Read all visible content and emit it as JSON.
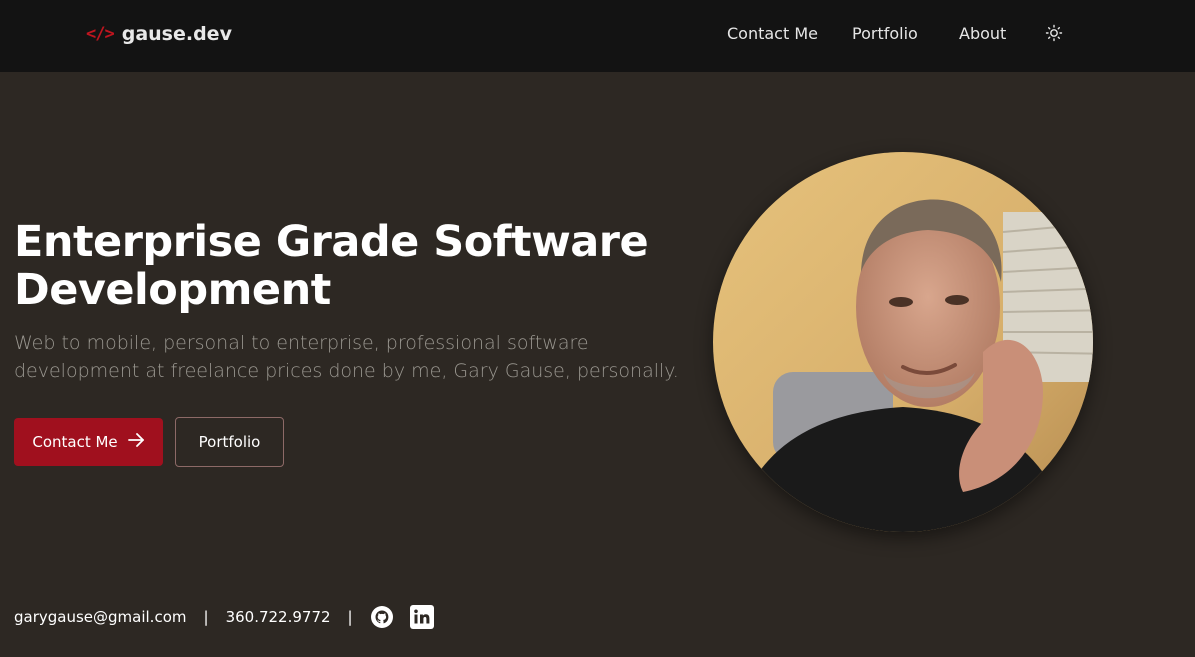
{
  "header": {
    "logo_icon": "</>",
    "logo_text": "gause.dev",
    "nav": [
      "Contact Me",
      "Portfolio",
      "About"
    ],
    "theme_icon": "sun-icon"
  },
  "hero": {
    "title": "Enterprise Grade Software Development",
    "subtitle": "Web to mobile, personal to enterprise, professional software development at freelance prices done by me, Gary Gause, personally.",
    "primary_button": "Contact Me",
    "secondary_button": "Portfolio"
  },
  "contact": {
    "email": "garygause@gmail.com",
    "separator": "|",
    "phone": "360.722.9772",
    "social_icons": [
      "github-icon",
      "linkedin-icon"
    ]
  },
  "colors": {
    "background": "#2d2823",
    "header_bg": "#131313",
    "accent": "#a0101e",
    "logo_icon": "#c0151f"
  }
}
